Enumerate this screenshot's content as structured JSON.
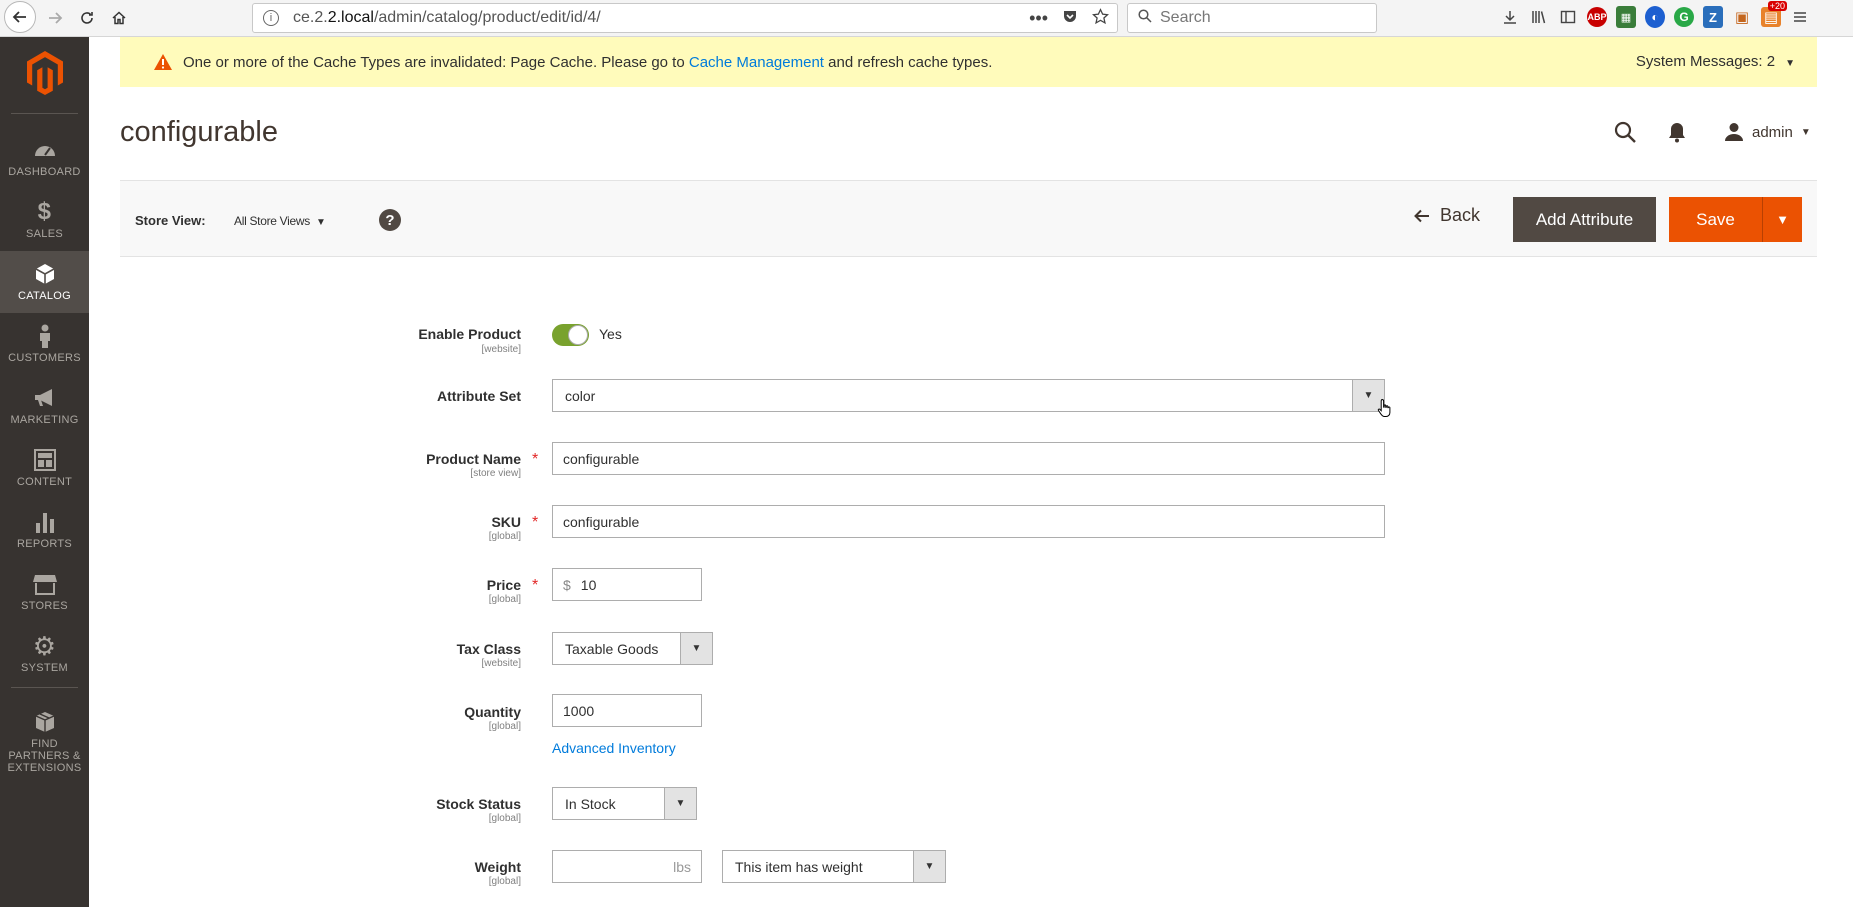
{
  "browser": {
    "url_prefix": "ce.2.",
    "url_host": "2.local",
    "url_path": "/admin/catalog/product/edit/id/4/",
    "search_placeholder": "Search",
    "badge_count": "+20"
  },
  "sidebar": {
    "items": [
      {
        "label": "DASHBOARD",
        "icon": "dashboard-icon"
      },
      {
        "label": "SALES",
        "icon": "dollar-icon"
      },
      {
        "label": "CATALOG",
        "icon": "cube-icon"
      },
      {
        "label": "CUSTOMERS",
        "icon": "person-icon"
      },
      {
        "label": "MARKETING",
        "icon": "megaphone-icon"
      },
      {
        "label": "CONTENT",
        "icon": "layout-icon"
      },
      {
        "label": "REPORTS",
        "icon": "bar-chart-icon"
      },
      {
        "label": "STORES",
        "icon": "store-icon"
      },
      {
        "label": "SYSTEM",
        "icon": "gear-icon"
      },
      {
        "label_lines": [
          "FIND",
          "PARTNERS &",
          "EXTENSIONS"
        ],
        "icon": "box-icon"
      }
    ],
    "active_index": 2
  },
  "notice": {
    "text_before": "One or more of the Cache Types are invalidated: Page Cache. Please go to ",
    "link": "Cache Management",
    "text_after": " and refresh cache types.",
    "system_messages": "System Messages: 2"
  },
  "header": {
    "title": "configurable",
    "user": "admin"
  },
  "actions": {
    "store_view_label": "Store View:",
    "store_view_value": "All Store Views",
    "back": "Back",
    "add_attribute": "Add Attribute",
    "save": "Save"
  },
  "form": {
    "enable_product": {
      "label": "Enable Product",
      "scope": "[website]",
      "value": "Yes"
    },
    "attribute_set": {
      "label": "Attribute Set",
      "value": "color"
    },
    "product_name": {
      "label": "Product Name",
      "scope": "[store view]",
      "value": "configurable"
    },
    "sku": {
      "label": "SKU",
      "scope": "[global]",
      "value": "configurable"
    },
    "price": {
      "label": "Price",
      "scope": "[global]",
      "currency": "$",
      "value": "10"
    },
    "tax_class": {
      "label": "Tax Class",
      "scope": "[website]",
      "value": "Taxable Goods"
    },
    "quantity": {
      "label": "Quantity",
      "scope": "[global]",
      "value": "1000",
      "link": "Advanced Inventory"
    },
    "stock_status": {
      "label": "Stock Status",
      "scope": "[global]",
      "value": "In Stock"
    },
    "weight": {
      "label": "Weight",
      "scope": "[global]",
      "unit": "lbs",
      "type_value": "This item has weight"
    }
  },
  "colors": {
    "sidebar_bg": "#373330",
    "notice_bg": "#fffbbb",
    "primary_orange": "#eb5202",
    "secondary_brown": "#514943",
    "link_blue": "#007bdb",
    "toggle_green": "#79a22e"
  }
}
